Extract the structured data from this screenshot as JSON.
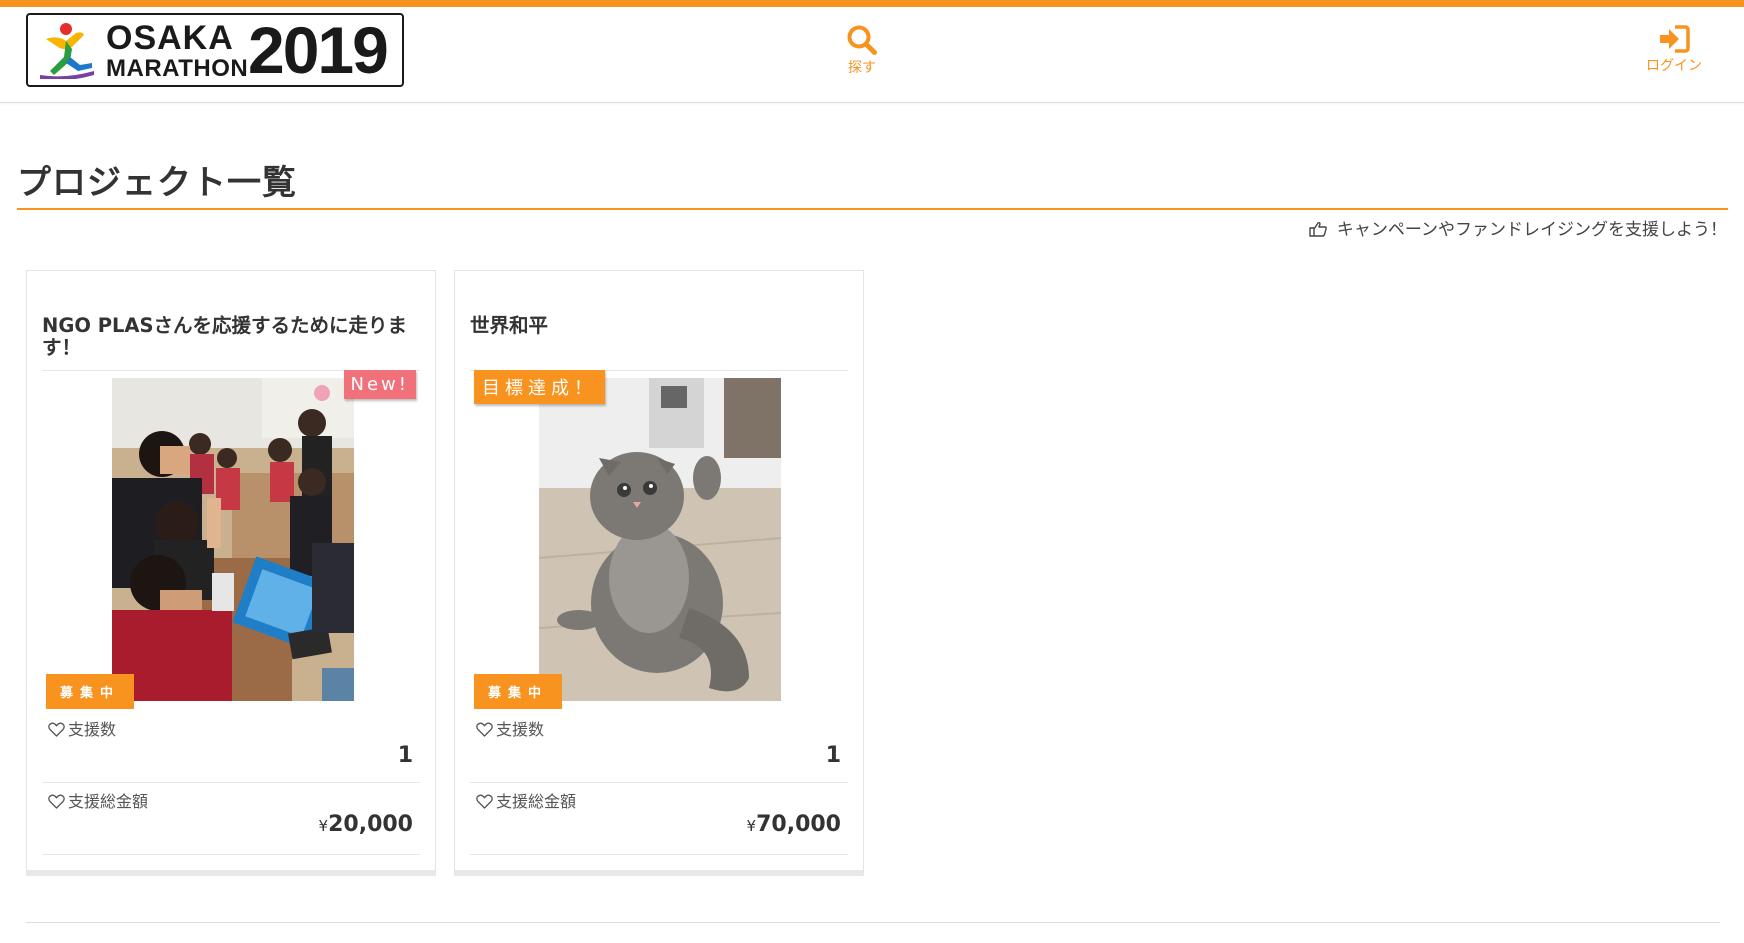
{
  "header": {
    "logo": {
      "line1": "OSAKA",
      "line2": "MARATHON",
      "year": "2019"
    },
    "nav": [
      {
        "label": "探す",
        "icon": "search-icon"
      },
      {
        "label": "ログイン",
        "icon": "login-icon"
      }
    ]
  },
  "page": {
    "title": "プロジェクト一覧",
    "tagline": "キャンペーンやファンドレイジングを支援しよう！"
  },
  "projects": [
    {
      "title": "NGO PLASさんを応援するために走ります！",
      "badge": "New!",
      "status": "募集中",
      "supporters_label": "支援数",
      "supporters": "1",
      "total_label": "支援総金額",
      "currency": "¥",
      "total": "20,000",
      "image": "classroom-photo"
    },
    {
      "title": "世界和平",
      "badge": "目標達成！",
      "status": "募集中",
      "supporters_label": "支援数",
      "supporters": "1",
      "total_label": "支援総金額",
      "currency": "¥",
      "total": "70,000",
      "image": "kitten-photo"
    }
  ],
  "colors": {
    "accent": "#f7931e",
    "new_badge": "#f0717a",
    "text": "#333333"
  }
}
